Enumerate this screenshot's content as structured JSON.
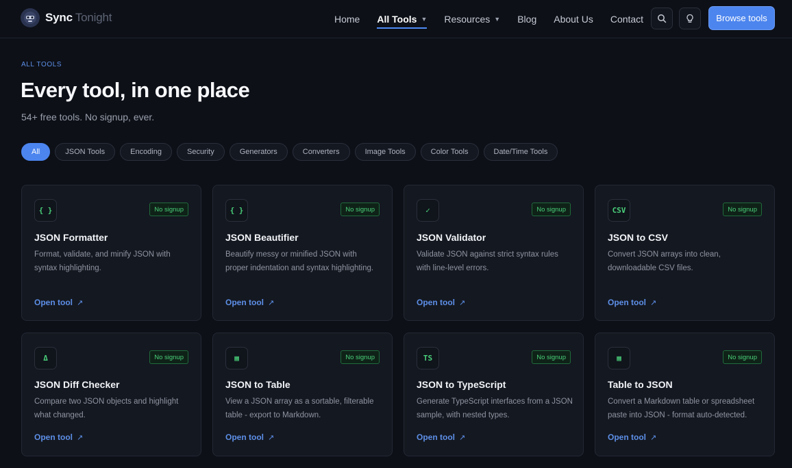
{
  "brand": {
    "name": "Sync",
    "suffix": "Tonight"
  },
  "nav": {
    "links": [
      {
        "label": "Home"
      },
      {
        "label": "All Tools"
      },
      {
        "label": "Resources"
      },
      {
        "label": "Blog"
      },
      {
        "label": "About Us"
      },
      {
        "label": "Contact"
      }
    ],
    "browse_label": "Browse tools",
    "icons": [
      "search-icon",
      "lightbulb-icon"
    ]
  },
  "hero": {
    "eyebrow": "ALL TOOLS",
    "title": "Every tool, in one place",
    "subtitle": "54+ free tools. No signup, ever."
  },
  "filters": [
    "All",
    "JSON Tools",
    "Encoding",
    "Security",
    "Generators",
    "Converters",
    "Image Tools",
    "Color Tools",
    "Date/Time Tools"
  ],
  "cards": [
    {
      "icon": "{ }",
      "badge": "No signup",
      "title": "JSON Formatter",
      "desc": "Format, validate, and minify JSON with syntax highlighting.",
      "link": "Open tool"
    },
    {
      "icon": "{ }",
      "badge": "No signup",
      "title": "JSON Beautifier",
      "desc": "Beautify messy or minified JSON with proper indentation and syntax highlighting.",
      "link": "Open tool"
    },
    {
      "icon": "✓",
      "badge": "No signup",
      "title": "JSON Validator",
      "desc": "Validate JSON against strict syntax rules with line-level errors.",
      "link": "Open tool"
    },
    {
      "icon": "CSV",
      "badge": "No signup",
      "title": "JSON to CSV",
      "desc": "Convert JSON arrays into clean, downloadable CSV files.",
      "link": "Open tool"
    },
    {
      "icon": "Δ",
      "badge": "No signup",
      "title": "JSON Diff Checker",
      "desc": "Compare two JSON objects and highlight what changed.",
      "link": "Open tool"
    },
    {
      "icon": "▦",
      "badge": "No signup",
      "title": "JSON to Table",
      "desc": "View a JSON array as a sortable, filterable table - export to Markdown.",
      "link": "Open tool"
    },
    {
      "icon": "TS",
      "badge": "No signup",
      "title": "JSON to TypeScript",
      "desc": "Generate TypeScript interfaces from a JSON sample, with nested types.",
      "link": "Open tool"
    },
    {
      "icon": "▦",
      "badge": "No signup",
      "title": "Table to JSON",
      "desc": "Convert a Markdown table or spreadsheet paste into JSON - format auto-detected.",
      "link": "Open tool"
    }
  ],
  "colors": {
    "accent": "#4c85ee",
    "badge_green": "#4ad07a",
    "background": "#0d1017"
  }
}
